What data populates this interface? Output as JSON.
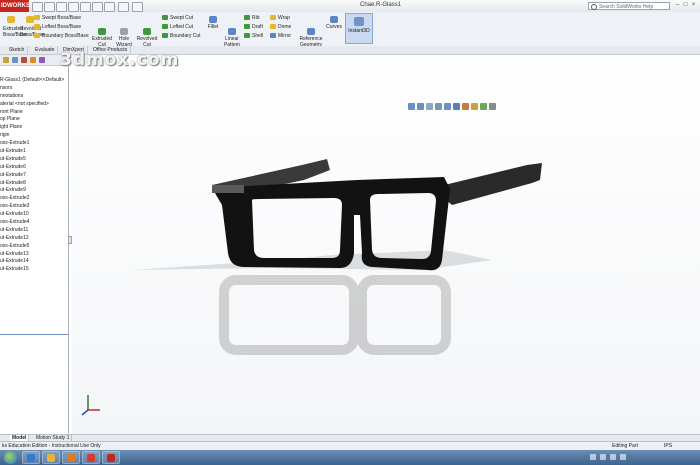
{
  "app": {
    "logo_text": "IDWORKS",
    "document_title": "Chae.R-Glass1",
    "search_placeholder": "Search SolidWorks Help",
    "window_buttons": [
      "–",
      "□",
      "×"
    ]
  },
  "watermark": {
    "text": "3dmox.com"
  },
  "ribbon": {
    "features_left": [
      {
        "label": "Extruded\nBoss/Base"
      },
      {
        "label": "Revolved\nBoss/Base"
      }
    ],
    "boss_small": [
      {
        "label": "Swept Boss/Base"
      },
      {
        "label": "Lofted Boss/Base"
      },
      {
        "label": "Boundary Boss/Base"
      }
    ],
    "cut_large": [
      {
        "label": "Extruded\nCut"
      },
      {
        "label": "Hole\nWizard"
      },
      {
        "label": "Revolved\nCut"
      }
    ],
    "cut_small": [
      {
        "label": "Swept Cut"
      },
      {
        "label": "Lofted Cut"
      },
      {
        "label": "Boundary Cut"
      }
    ],
    "fillet": {
      "label": "Fillet"
    },
    "linear_pattern": {
      "label": "Linear\nPattern"
    },
    "rib_group": [
      {
        "label": "Rib"
      },
      {
        "label": "Draft"
      },
      {
        "label": "Shell"
      }
    ],
    "wrap_group": [
      {
        "label": "Wrap"
      },
      {
        "label": "Dome"
      },
      {
        "label": "Mirror"
      }
    ],
    "reference_geometry": {
      "label": "Reference\nGeometry"
    },
    "curves": {
      "label": "Curves"
    },
    "instant3d": {
      "label": "Instant3D"
    }
  },
  "command_tabs": [
    {
      "label": "Sketch",
      "active": false
    },
    {
      "label": "Evaluate",
      "active": false
    },
    {
      "label": "DimXpert",
      "active": false
    },
    {
      "label": "Office Products",
      "active": false
    }
  ],
  "feature_tree": {
    "items": [
      "R-Glass1  (Default<<Default>",
      "nsors",
      "nnotations",
      "aterial <not specified>",
      "ront Plane",
      "op Plane",
      "ight Plane",
      "rigin",
      "oss-Extrude1",
      "ut-Extrude1",
      "ut-Extrude5",
      "ut-Extrude6",
      "ut-Extrude7",
      "ut-Extrude8",
      "ut-Extrude9",
      "oss-Extrude2",
      "oss-Extrude3",
      "ut-Extrude10",
      "oss-Extrude4",
      "ut-Extrude11",
      "ut-Extrude12",
      "oss-Extrude5",
      "ut-Extrude13",
      "ut-Extrude14",
      "ut-Extrude15"
    ]
  },
  "bottom_tabs": [
    {
      "label": "Model",
      "active": true
    },
    {
      "label": "Motion Study 1",
      "active": false
    }
  ],
  "status": {
    "left": "ks Education Edition - Instructional Use Only",
    "mode": "Editing Part",
    "units": "IPS"
  },
  "taskbar": {
    "apps": [
      {
        "name": "internet-explorer",
        "color": "#2f7bd6"
      },
      {
        "name": "file-explorer",
        "color": "#e6b53a"
      },
      {
        "name": "media-player",
        "color": "#e07a1f"
      },
      {
        "name": "security",
        "color": "#d83b2e"
      },
      {
        "name": "solidworks",
        "color": "#c5251f"
      }
    ]
  }
}
